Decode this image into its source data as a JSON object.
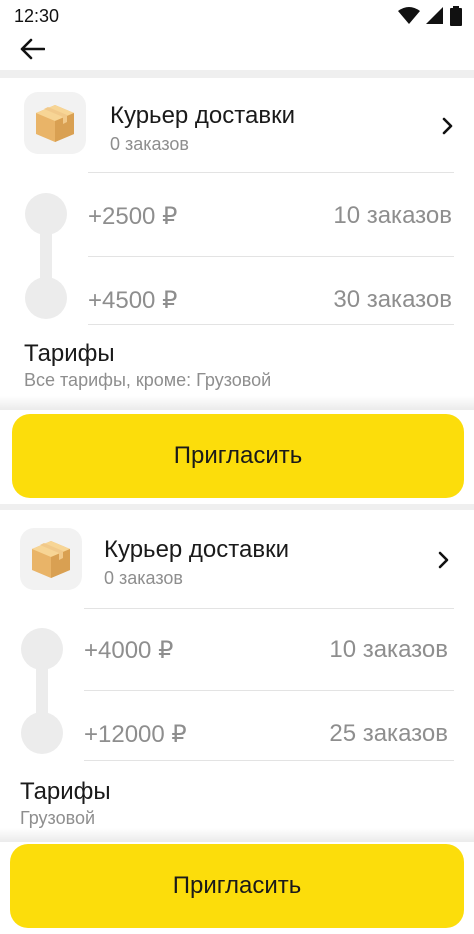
{
  "status_bar": {
    "time": "12:30",
    "icons": [
      "wifi-icon",
      "cellular-icon",
      "battery-icon"
    ]
  },
  "app_bar": {
    "back_icon": "arrow-left-icon"
  },
  "cards": [
    {
      "title": "Курьер доставки",
      "subtitle": "0 заказов",
      "icon": "package-box-icon",
      "tiers": [
        {
          "amount": "+2500 ₽",
          "orders": "10 заказов"
        },
        {
          "amount": "+4500 ₽",
          "orders": "30 заказов"
        }
      ],
      "tariffs_label": "Тарифы",
      "tariffs_value": "Все тарифы, кроме: Грузовой",
      "button_label": "Пригласить"
    },
    {
      "title": "Курьер доставки",
      "subtitle": "0 заказов",
      "icon": "package-box-icon",
      "tiers": [
        {
          "amount": "+4000 ₽",
          "orders": "10 заказов"
        },
        {
          "amount": "+12000 ₽",
          "orders": "25 заказов"
        }
      ],
      "tariffs_label": "Тарифы",
      "tariffs_value": "Грузовой",
      "button_label": "Пригласить"
    }
  ],
  "colors": {
    "accent_yellow": "#fcdd0b",
    "muted_text": "#8e8e8e",
    "primary_text": "#1a1a1a",
    "timeline": "#ececec"
  }
}
